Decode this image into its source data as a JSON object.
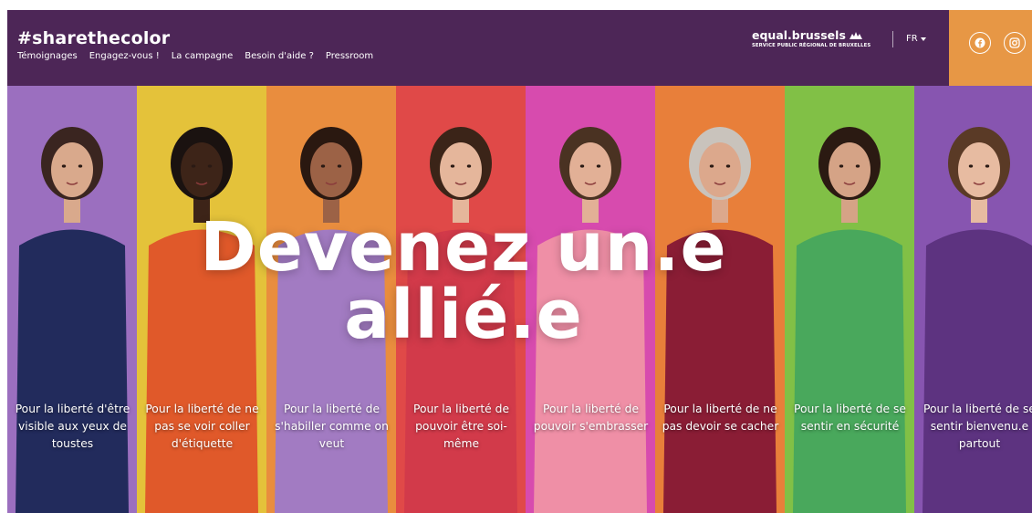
{
  "header": {
    "brand": "#sharethecolor",
    "nav": [
      "Témoignages",
      "Engagez-vous !",
      "La campagne",
      "Besoin d'aide ?",
      "Pressroom"
    ],
    "logo_main": "equal.brussels",
    "logo_sub": "SERVICE PUBLIC RÉGIONAL DE BRUXELLES",
    "language": "FR",
    "social": [
      "facebook-icon",
      "instagram-icon"
    ]
  },
  "hero": {
    "headline_line1": "Devenez un.e",
    "headline_line2": "allié.e",
    "panels": [
      {
        "caption": "Pour la liberté d'être visible aux yeux de toustes",
        "bg": "#9b6fbf",
        "top": "#222b5c",
        "skin": "#d9a98c",
        "hair": "#3a2520"
      },
      {
        "caption": "Pour la liberté de ne pas se voir coller d'étiquette",
        "bg": "#e4c23a",
        "top": "#e0592a",
        "skin": "#3d2418",
        "hair": "#1a1210"
      },
      {
        "caption": "Pour la liberté de s'habiller comme on veut",
        "bg": "#e98d3e",
        "top": "#a27bc2",
        "skin": "#9c6246",
        "hair": "#2a1810"
      },
      {
        "caption": "Pour la liberté de pouvoir être soi-même",
        "bg": "#e04948",
        "top": "#d23a4a",
        "skin": "#e5b69b",
        "hair": "#3b2418"
      },
      {
        "caption": "Pour la liberté de pouvoir s'embrasser",
        "bg": "#d74bae",
        "top": "#ef8fa6",
        "skin": "#e2b096",
        "hair": "#4a3222"
      },
      {
        "caption": "Pour la liberté de ne pas devoir se cacher",
        "bg": "#e87f3a",
        "top": "#8a1d35",
        "skin": "#dca88c",
        "hair": "#c9c3bc"
      },
      {
        "caption": "Pour la liberté de se sentir en sécurité",
        "bg": "#81c046",
        "top": "#49a85c",
        "skin": "#d5a386",
        "hair": "#2b1a12"
      },
      {
        "caption": "Pour la liberté de se sentir bienvenu.e partout",
        "bg": "#8755b0",
        "top": "#5d3380",
        "skin": "#e7bba1",
        "hair": "#5a3a26"
      }
    ]
  }
}
